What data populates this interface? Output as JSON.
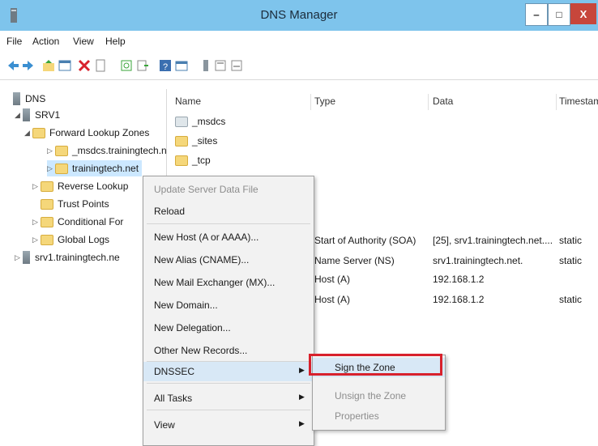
{
  "window": {
    "title": "DNS Manager",
    "min_symbol": "‒",
    "max_symbol": "□",
    "close_symbol": "X"
  },
  "menu": [
    "File",
    "Action",
    "View",
    "Help"
  ],
  "tree": {
    "root": "DNS",
    "server": "SRV1",
    "forward_zones": "Forward Lookup Zones",
    "msdcs_zone": "_msdcs.trainingtech.n",
    "trainingtech_zone": "trainingtech.net",
    "reverse_zones": "Reverse Lookup",
    "trust_points": "Trust Points",
    "conditional": "Conditional For",
    "global_logs": "Global Logs",
    "srv1_fqdn": "srv1.trainingtech.ne"
  },
  "list": {
    "columns": [
      "Name",
      "Type",
      "Data",
      "Timestam"
    ],
    "folders": [
      "_msdcs",
      "_sites",
      "_tcp"
    ],
    "records": [
      {
        "type": "Start of Authority (SOA)",
        "data": "[25], srv1.trainingtech.net....",
        "timestamp": "static"
      },
      {
        "type": "Name Server (NS)",
        "data": "srv1.trainingtech.net.",
        "timestamp": "static"
      },
      {
        "type": "Host (A)",
        "data": "192.168.1.2",
        "timestamp": ""
      },
      {
        "type": "Host (A)",
        "data": "192.168.1.2",
        "timestamp": "static"
      }
    ]
  },
  "context_menu": {
    "items": [
      "Update Server Data File",
      "Reload",
      "New Host (A or AAAA)...",
      "New Alias (CNAME)...",
      "New Mail Exchanger (MX)...",
      "New Domain...",
      "New Delegation...",
      "Other New Records...",
      "DNSSEC",
      "All Tasks",
      "View"
    ]
  },
  "dnssec_submenu": [
    "Sign the Zone",
    "Unsign the Zone",
    "Properties"
  ],
  "colors": {
    "titlebar": "#7ec4ec",
    "close": "#c7463b",
    "highlight_box": "#d8212c"
  }
}
